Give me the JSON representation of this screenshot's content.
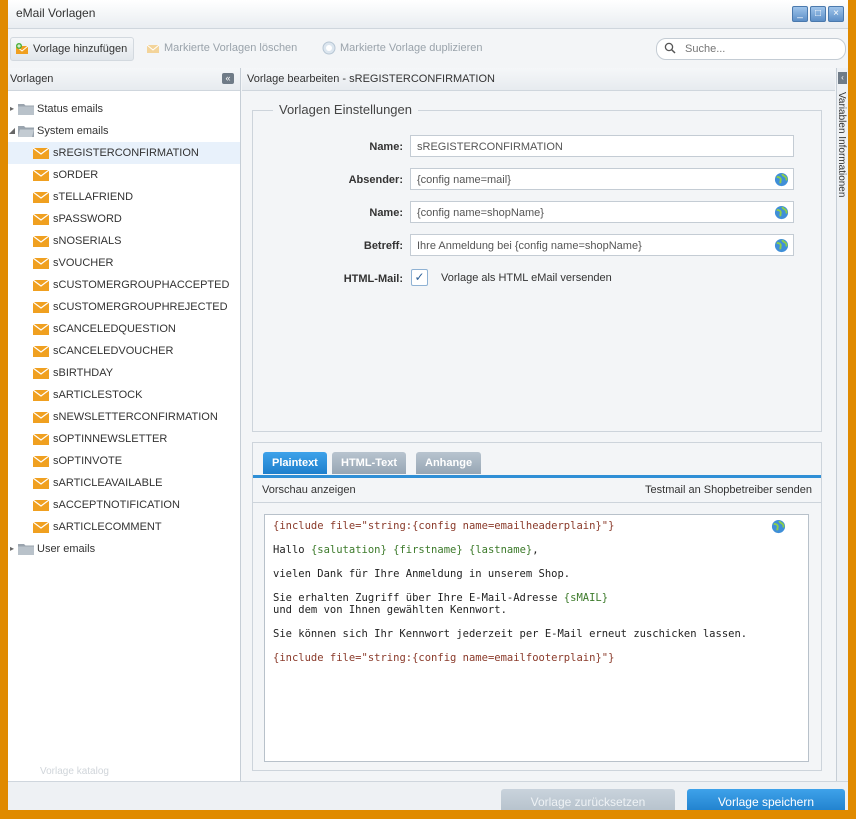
{
  "window": {
    "title": "eMail Vorlagen",
    "buttons": [
      "_",
      "□",
      "×"
    ]
  },
  "toolbar": {
    "add_label": "Vorlage hinzufügen",
    "delete_label": "Markierte Vorlagen löschen",
    "duplicate_label": "Markierte Vorlage duplizieren",
    "search_placeholder": "Suche..."
  },
  "left": {
    "header": "Vorlagen",
    "collapse": "«",
    "folders": {
      "status": "Status emails",
      "system": "System emails",
      "user": "User emails"
    },
    "templates": [
      "sREGISTERCONFIRMATION",
      "sORDER",
      "sTELLAFRIEND",
      "sPASSWORD",
      "sNOSERIALS",
      "sVOUCHER",
      "sCUSTOMERGROUPHACCEPTED",
      "sCUSTOMERGROUPHREJECTED",
      "sCANCELEDQUESTION",
      "sCANCELEDVOUCHER",
      "sBIRTHDAY",
      "sARTICLESTOCK",
      "sNEWSLETTERCONFIRMATION",
      "sOPTINNEWSLETTER",
      "sOPTINVOTE",
      "sARTICLEAVAILABLE",
      "sACCEPTNOTIFICATION",
      "sARTICLECOMMENT"
    ],
    "footer": "Vorlage katalog"
  },
  "editor": {
    "header": "Vorlage bearbeiten - sREGISTERCONFIRMATION",
    "settings_legend": "Vorlagen Einstellungen",
    "fields": {
      "name_label": "Name:",
      "name_value": "sREGISTERCONFIRMATION",
      "sender_label": "Absender:",
      "sender_value": "{config name=mail}",
      "sender_name_label": "Name:",
      "sender_name_value": "{config name=shopName}",
      "subject_label": "Betreff:",
      "subject_value": "Ihre Anmeldung bei {config name=shopName}",
      "html_label": "HTML-Mail:",
      "html_checkbox_label": "Vorlage als HTML eMail versenden",
      "html_checked": "✓"
    },
    "tabs": {
      "plain": "Plaintext",
      "html": "HTML-Text",
      "attachments": "Anhange"
    },
    "preview_label": "Vorschau anzeigen",
    "testmail_label": "Testmail an Shopbetreiber senden",
    "content": {
      "l1_a": "{include file=",
      "l1_b": "\"string:{config name=emailheaderplain}\"",
      "l1_c": "}",
      "l2_a": "Hallo ",
      "l2_b": "{salutation}",
      "l2_c": " ",
      "l2_d": "{firstname}",
      "l2_e": " ",
      "l2_f": "{lastname}",
      "l2_g": ",",
      "l3": "vielen Dank für Ihre Anmeldung in unserem Shop.",
      "l4_a": "Sie erhalten Zugriff über Ihre E-Mail-Adresse ",
      "l4_b": "{sMAIL}",
      "l5": "und dem von Ihnen gewählten Kennwort.",
      "l6": "Sie können sich Ihr Kennwort jederzeit per E-Mail erneut zuschicken lassen.",
      "l7_a": "{include file=",
      "l7_b": "\"string:{config name=emailfooterplain}\"",
      "l7_c": "}"
    }
  },
  "side_panel": {
    "label": "Variablen Informationen",
    "arrow": "‹"
  },
  "footer": {
    "reset_label": "Vorlage zurücksetzen",
    "save_label": "Vorlage speichern"
  },
  "colors": {
    "accent": "#1e7fcc",
    "frame": "#e08a00",
    "envelope": "#f0a020"
  }
}
